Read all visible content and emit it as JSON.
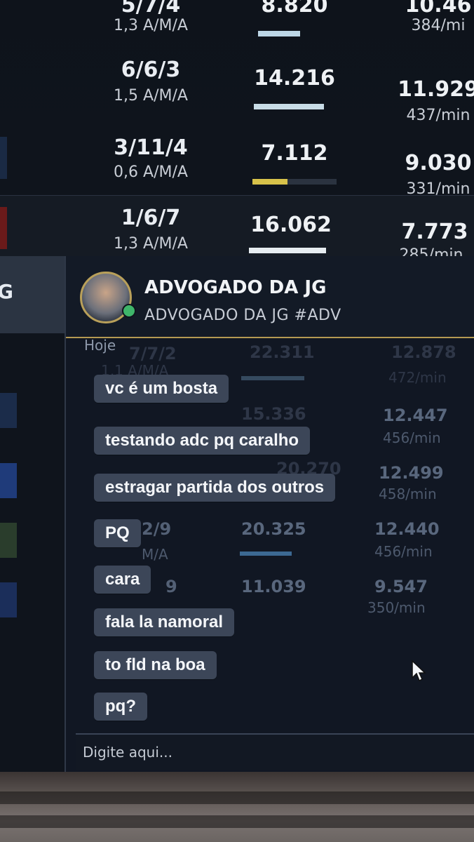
{
  "scoreboard": [
    {
      "kda": "5/7/4",
      "ratio": "1,3 A/M/A",
      "damage": "8.820",
      "damage_fraction": 0.5,
      "gold": "10.46",
      "gold_min": "384/mi"
    },
    {
      "kda": "6/6/3",
      "ratio": "1,5 A/M/A",
      "damage": "14.216",
      "damage_fraction": 0.8,
      "gold": "11.929",
      "gold_min": "437/min"
    },
    {
      "kda": "3/11/4",
      "ratio": "0,6 A/M/A",
      "damage": "7.112",
      "damage_fraction": 0.42,
      "gold": "9.030",
      "gold_min": "331/min"
    },
    {
      "kda": "1/6/7",
      "ratio": "1,3 A/M/A",
      "damage": "16.062",
      "damage_fraction": 0.92,
      "gold": "7.773",
      "gold_min": "285/min"
    }
  ],
  "left_letter": "G",
  "chat": {
    "friend_name": "ADVOGADO DA JG",
    "friend_tag": "ADVOGADO DA JG #ADV",
    "date_label": "Hoje",
    "messages": [
      "vc é um bosta",
      "testando adc pq caralho",
      "estragar partida dos outros",
      "PQ",
      "cara",
      "fala la namoral",
      "to fld na boa",
      "pq?"
    ],
    "input_placeholder": "Digite aqui..."
  },
  "background_scoreboard": {
    "row1": {
      "kda": "7/7/2",
      "ratio": "1,1 A/M/A",
      "damage": "22.311",
      "gold": "12.878",
      "gold_min": "472/min"
    },
    "row2": {
      "damage": "15.336",
      "gold": "12.447",
      "gold_min": "456/min"
    },
    "row3": {
      "damage": "20.270",
      "gold": "12.499",
      "gold_min": "458/min"
    },
    "row4": {
      "kda": "2/9",
      "ratio": "M/A",
      "damage": "20.325",
      "gold": "12.440",
      "gold_min": "456/min"
    },
    "row5": {
      "kda": "9",
      "damage": "11.039",
      "gold": "9.547",
      "gold_min": "350/min"
    }
  },
  "colors": {
    "accent_gold": "#b49a52",
    "bubble": "#3c4658",
    "online": "#3fb56a",
    "yellow_bar": "#d8c24a"
  }
}
